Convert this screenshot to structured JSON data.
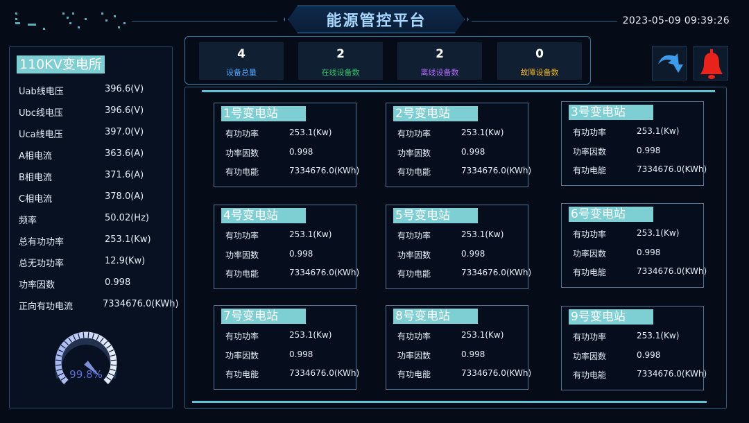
{
  "header": {
    "title": "能源管控平台",
    "datetime": "2023-05-09 09:39:26"
  },
  "colors": {
    "accent": "#7ecfd3",
    "total": "#4ba4ff",
    "online": "#31c46a",
    "offline": "#b46cff",
    "fault": "#f0b323",
    "alarm": "#e8231c"
  },
  "left_panel": {
    "station": "110KV变电所",
    "params": [
      {
        "name": "Uab线电压",
        "value": "396.6(V)"
      },
      {
        "name": "Ubc线电压",
        "value": "396.6(V)"
      },
      {
        "name": "Uca线电压",
        "value": "397.0(V)"
      },
      {
        "name": "A相电流",
        "value": "363.6(A)"
      },
      {
        "name": "B相电流",
        "value": "371.6(A)"
      },
      {
        "name": "C相电流",
        "value": "378.0(A)"
      },
      {
        "name": "频率",
        "value": "50.02(Hz)"
      },
      {
        "name": "总有功功率",
        "value": "253.1(Kw)"
      },
      {
        "name": "总无功功率",
        "value": "12.9(Kw)"
      },
      {
        "name": "功率因数",
        "value": "0.998"
      },
      {
        "name": "正向有功电流",
        "value": "7334676.0(KWh)"
      }
    ],
    "gauge": {
      "value_text": "99.8%",
      "fraction": 0.998
    }
  },
  "stats": [
    {
      "value": "4",
      "label": "设备总量"
    },
    {
      "value": "2",
      "label": "在线设备数"
    },
    {
      "value": "2",
      "label": "离线设备数"
    },
    {
      "value": "0",
      "label": "故障设备数"
    }
  ],
  "icons": {
    "refresh": "redo-arrow-icon",
    "alarm": "bell-icon"
  },
  "stations": [
    {
      "title": "1号变电站",
      "rows": [
        {
          "name": "有功功率",
          "value": "253.1(Kw)"
        },
        {
          "name": "功率因数",
          "value": "0.998"
        },
        {
          "name": "有功电能",
          "value": "7334676.0(KWh)"
        }
      ]
    },
    {
      "title": "2号变电站",
      "rows": [
        {
          "name": "有功功率",
          "value": "253.1(Kw)"
        },
        {
          "name": "功率因数",
          "value": "0.998"
        },
        {
          "name": "有功电能",
          "value": "7334676.0(KWh)"
        }
      ]
    },
    {
      "title": "3号变电站",
      "rows": [
        {
          "name": "有功功率",
          "value": "253.1(Kw)"
        },
        {
          "name": "功率因数",
          "value": "0.998"
        },
        {
          "name": "有功电能",
          "value": "7334676.0(KWh)"
        }
      ]
    },
    {
      "title": "4号变电站",
      "rows": [
        {
          "name": "有功功率",
          "value": "253.1(Kw)"
        },
        {
          "name": "功率因数",
          "value": "0.998"
        },
        {
          "name": "有功电能",
          "value": "7334676.0(KWh)"
        }
      ]
    },
    {
      "title": "5号变电站",
      "rows": [
        {
          "name": "有功功率",
          "value": "253.1(Kw)"
        },
        {
          "name": "功率因数",
          "value": "0.998"
        },
        {
          "name": "有功电能",
          "value": "7334676.0(KWh)"
        }
      ]
    },
    {
      "title": "6号变电站",
      "rows": [
        {
          "name": "有功功率",
          "value": "253.1(Kw)"
        },
        {
          "name": "功率因数",
          "value": "0.998"
        },
        {
          "name": "有功电能",
          "value": "7334676.0(KWh)"
        }
      ]
    },
    {
      "title": "7号变电站",
      "rows": [
        {
          "name": "有功功率",
          "value": "253.1(Kw)"
        },
        {
          "name": "功率因数",
          "value": "0.998"
        },
        {
          "name": "有功电能",
          "value": "7334676.0(KWh)"
        }
      ]
    },
    {
      "title": "8号变电站",
      "rows": [
        {
          "name": "有功功率",
          "value": "253.1(Kw)"
        },
        {
          "name": "功率因数",
          "value": "0.998"
        },
        {
          "name": "有功电能",
          "value": "7334676.0(KWh)"
        }
      ]
    },
    {
      "title": "9号变电站",
      "rows": [
        {
          "name": "有功功率",
          "value": "253.1(Kw)"
        },
        {
          "name": "功率因数",
          "value": "0.998"
        },
        {
          "name": "有功电能",
          "value": "7334676.0(KWh)"
        }
      ]
    }
  ]
}
